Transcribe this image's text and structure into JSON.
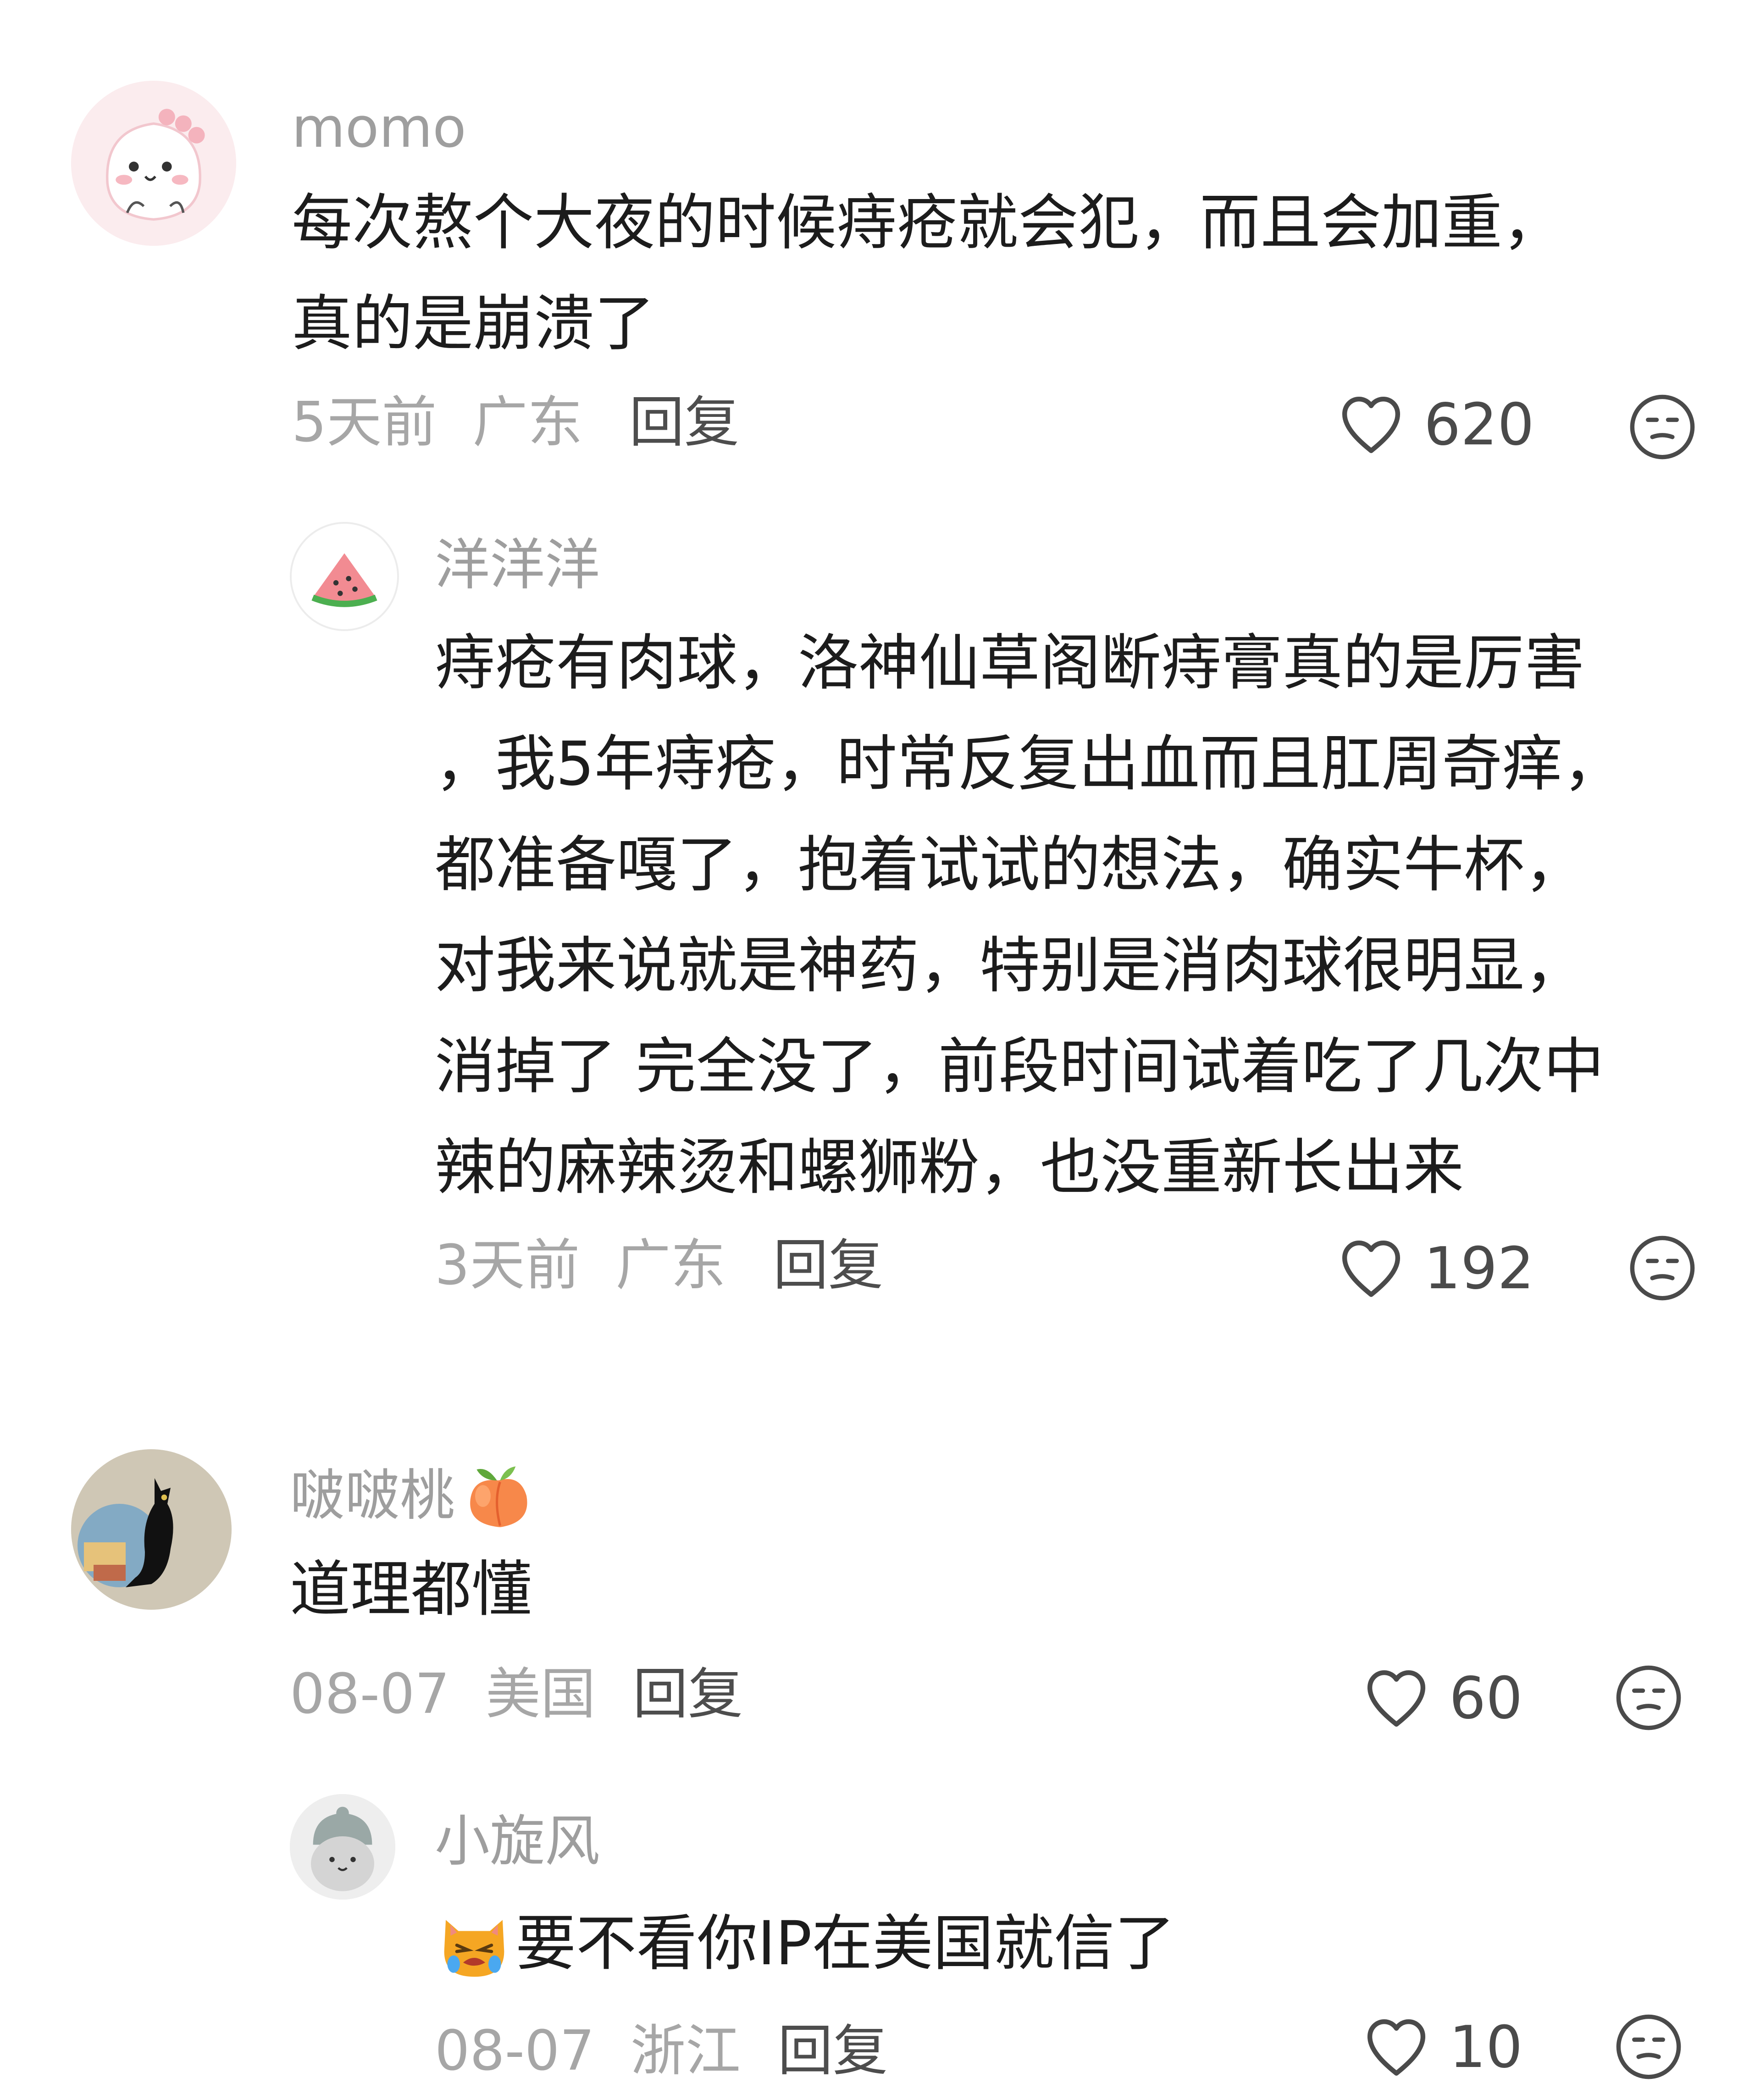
{
  "comments": [
    {
      "username": "momo",
      "content_lines": [
        "每次熬个大夜的时候痔疮就会犯，而且会加重，",
        "真的是崩溃了"
      ],
      "time": "5天前",
      "location": "广东",
      "reply_label": "回复",
      "likes": "620",
      "avatar_icon": "pink-monster-avatar"
    },
    {
      "username": "洋洋洋",
      "content_lines": [
        "痔疮有肉球，洛神仙草阁断痔膏真的是厉害",
        "，我5年痔疮，时常反复出血而且肛周奇痒，",
        "都准备嘎了，抱着试试的想法，确实牛杯，",
        "对我来说就是神药，特别是消肉球很明显，",
        "消掉了 完全没了，前段时间试着吃了几次中",
        "辣的麻辣烫和螺狮粉，也没重新长出来"
      ],
      "time": "3天前",
      "location": "广东",
      "reply_label": "回复",
      "likes": "192",
      "avatar_icon": "watermelon-avatar"
    },
    {
      "username": "啵啵桃",
      "username_emoji": "peach-emoji",
      "content_lines": [
        "道理都懂"
      ],
      "time": "08-07",
      "location": "美国",
      "reply_label": "回复",
      "likes": "60",
      "avatar_icon": "black-cat-avatar"
    },
    {
      "username": "小旋风",
      "content_emoji": "crying-cat-emoji",
      "content_lines": [
        "要不看你IP在美国就信了"
      ],
      "time": "08-07",
      "location": "浙江",
      "reply_label": "回复",
      "likes": "10",
      "avatar_icon": "gray-bear-avatar"
    }
  ],
  "icons": {
    "like": "heart-outline-icon",
    "reaction": "neutral-face-icon"
  },
  "colors": {
    "username": "#9e9e9e",
    "content": "#1c1c1c",
    "meta": "#a6a6a6",
    "reply": "#4d4d4d",
    "icon": "#4a4a4a"
  }
}
